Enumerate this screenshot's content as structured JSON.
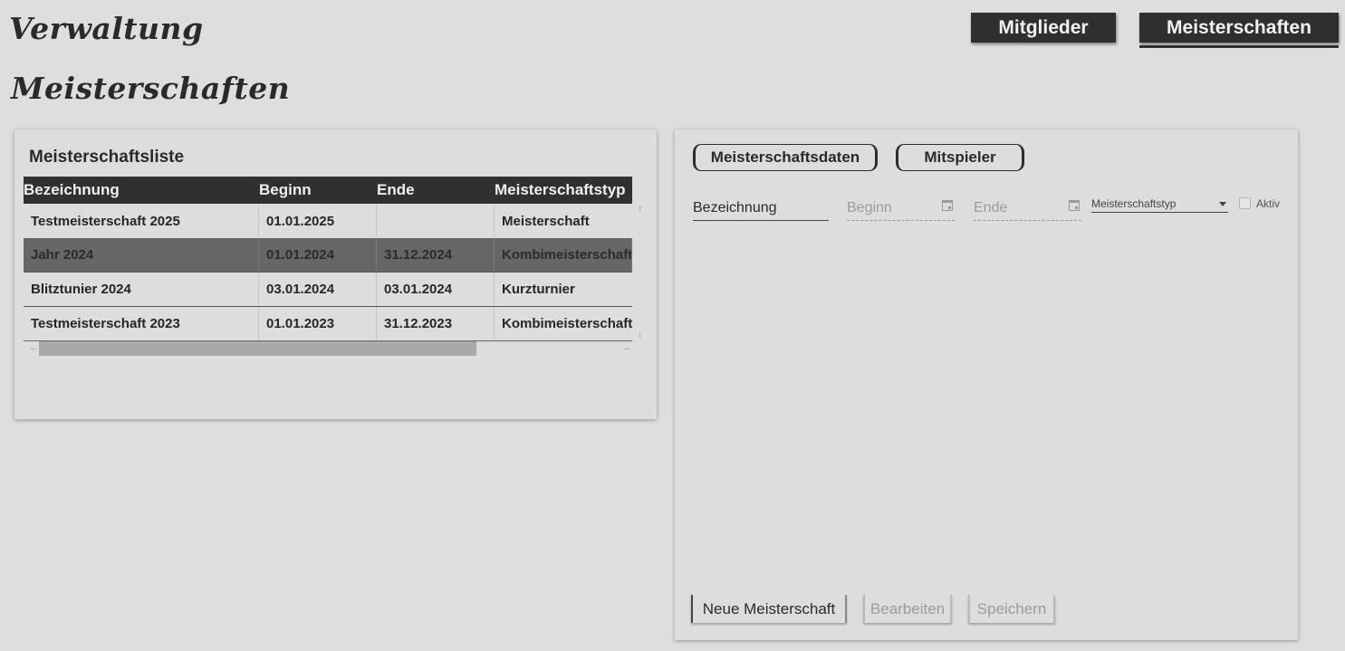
{
  "app": {
    "title": "Verwaltung"
  },
  "page": {
    "title": "Meisterschaften"
  },
  "nav": {
    "members": "Mitglieder",
    "championships": "Meisterschaften"
  },
  "list": {
    "heading": "Meisterschaftsliste",
    "columns": [
      "Bezeichnung",
      "Beginn",
      "Ende",
      "Meisterschaftstyp"
    ],
    "rows": [
      [
        "Testmeisterschaft 2025",
        "01.01.2025",
        "",
        "Meisterschaft"
      ],
      [
        "Jahr 2024",
        "01.01.2024",
        "31.12.2024",
        "Kombimeisterschaft"
      ],
      [
        "Blitztunier 2024",
        "03.01.2024",
        "03.01.2024",
        "Kurzturnier"
      ],
      [
        "Testmeisterschaft 2023",
        "01.01.2023",
        "31.12.2023",
        "Kombimeisterschaft"
      ]
    ],
    "selected_row": 1
  },
  "detail": {
    "tabs": [
      "Meisterschaftsdaten",
      "Mitspieler"
    ],
    "fields": {
      "name": "Bezeichnung",
      "begin": "Beginn",
      "end": "Ende",
      "type": "Meisterschaftstyp",
      "active": "Aktiv"
    },
    "buttons": {
      "new": "Neue Meisterschaft",
      "edit": "Bearbeiten",
      "save": "Speichern"
    }
  },
  "icons": {
    "calendar": "calendar-icon",
    "dropdown": "chevron-down-icon"
  },
  "colors": {
    "background": "#dedede",
    "header": "#303030",
    "selected_row": "#666666"
  }
}
